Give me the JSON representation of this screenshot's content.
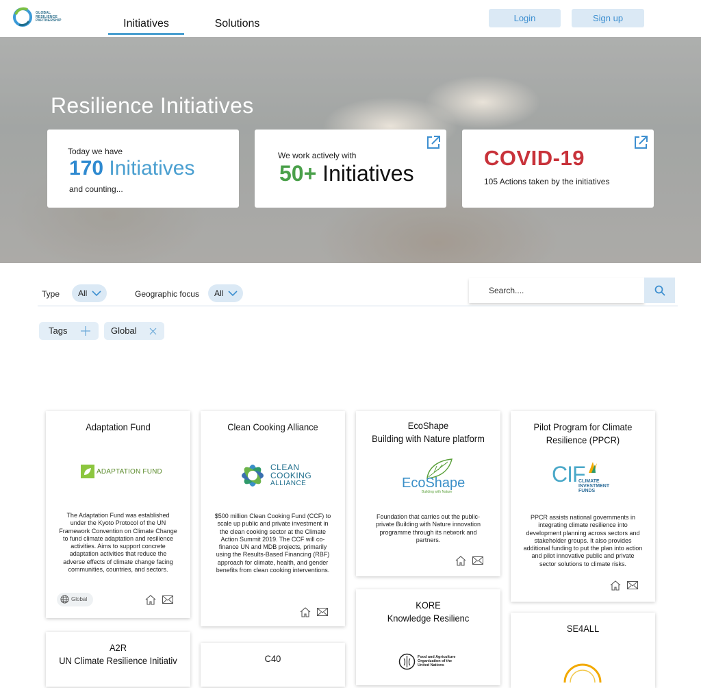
{
  "header": {
    "logo_text": [
      "GLOBAL",
      "RESILIENCE",
      "PARTNERSHIP"
    ],
    "nav": [
      {
        "label": "Initiatives",
        "active": true
      },
      {
        "label": "Solutions",
        "active": false
      }
    ],
    "login_label": "Login",
    "signup_label": "Sign up",
    "accent": "#4a9fd0"
  },
  "hero": {
    "title": "Resilience Initiatives",
    "card1": {
      "lead": "Today we have",
      "number": "170",
      "unit": "Initiatives",
      "tail": "and counting..."
    },
    "card2": {
      "lead": "We work actively with",
      "number": "50+",
      "unit": "Initiatives"
    },
    "card3": {
      "title": "COVID-19",
      "sub": "105 Actions taken by the initiatives"
    }
  },
  "filters": {
    "type_label": "Type",
    "type_value": "All",
    "geo_label": "Geographic focus",
    "geo_value": "All",
    "search_placeholder": "Search...."
  },
  "chips": {
    "tags_label": "Tags",
    "global_label": "Global"
  },
  "cards": [
    {
      "title": "Adaptation Fund",
      "logo_text": "ADAPTATION FUND",
      "description": "The Adaptation Fund was established under the Kyoto Protocol of the UN Framework Convention on Climate Change to fund climate adaptation and resilience activities. Aims to support concrete adaptation activities that reduce the adverse effects of climate change facing communities, countries, and sectors.",
      "badge": "Global"
    },
    {
      "title": "Clean Cooking Alliance",
      "logo_text": [
        "CLEAN",
        "COOKING",
        "ALLIANCE"
      ],
      "description": "$500 million Clean Cooking Fund (CCF) to scale up public and private investment in the clean cooking sector at the Climate Action Summit 2019. The CCF will co-finance UN and MDB projects, primarily using the Results-Based Financing (RBF) approach for climate, health, and gender benefits from clean cooking interventions."
    },
    {
      "title": "EcoShape\nBuilding with Nature platform",
      "logo_text": "EcoShape",
      "logo_sub": "Building with Nature",
      "description": "Foundation that carries out the public-private Building with Nature innovation programme through its network and partners."
    },
    {
      "title": "Pilot Program for Climate\nResilience (PPCR)",
      "logo_text": "CIF",
      "logo_sub": [
        "CLIMATE",
        "INVESTMENT",
        "FUNDS"
      ],
      "description": "PPCR assists national governments in integrating climate resilience into development planning across sectors and stakeholder groups. It also provides additional funding to put the plan into action and pilot innovative public and private sector solutions to climate risks."
    },
    {
      "title": "KORE\nKnowledge Resilienc",
      "logo_text": [
        "Food and Agriculture",
        "Organization of the",
        "United Nations"
      ]
    },
    {
      "title": "SE4ALL"
    },
    {
      "title": "A2R\nUN Climate Resilience Initiativ"
    },
    {
      "title": "C40"
    }
  ]
}
